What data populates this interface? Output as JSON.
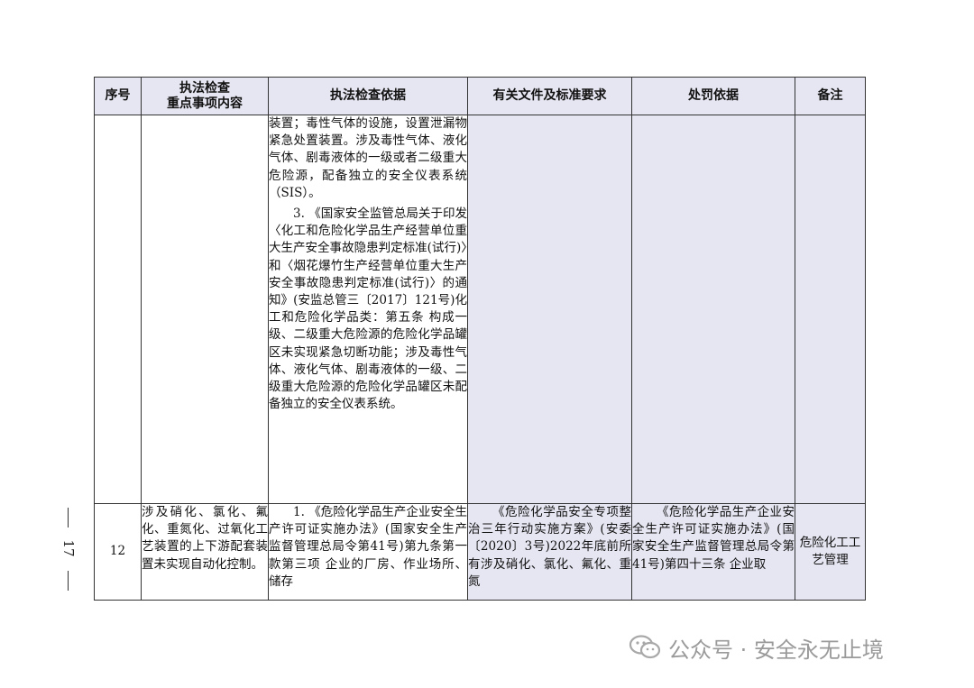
{
  "headers": [
    "序号",
    "执法检查\n重点事项内容",
    "执法检查依据",
    "有关文件及标准要求",
    "处罚依据",
    "备注"
  ],
  "row1": {
    "basis_p1": "装置；毒性气体的设施，设置泄漏物紧急处置装置。涉及毒性气体、液化气体、剧毒液体的一级或者二级重大危险源，配备独立的安全仪表系统（SIS）。",
    "basis_p2": "3. 《国家安全监管总局关于印发〈化工和危险化学品生产经营单位重大生产安全事故隐患判定标准(试行)〉和〈烟花爆竹生产经营单位重大生产安全事故隐患判定标准(试行)〉的通知》(安监总管三〔2017〕121号)化工和危险化学品类：第五条 构成一级、二级重大危险源的危险化学品罐区未实现紧急切断功能；涉及毒性气体、液化气体、剧毒液体的一级、二级重大危险源的危险化学品罐区未配备独立的安全仪表系统。"
  },
  "row2": {
    "seq": "12",
    "item": "涉及硝化、氯化、氟化、重氮化、过氧化工艺装置的上下游配套装置未实现自动化控制。",
    "basis": "1. 《危险化学品生产企业安全生产许可证实施办法》(国家安全生产监督管理总局令第41号)第九条第一款第三项 企业的厂房、作业场所、储存",
    "docs": "《危险化学品安全专项整治三年行动实施方案》(安委〔2020〕3号)2022年底前所有涉及硝化、氯化、氟化、重氮",
    "penalty": "《危险化学品生产企业安全生产许可证实施办法》(国家安全生产监督管理总局令第41号)第四十三条 企业取",
    "remark": "危险化工工艺管理"
  },
  "page_number": "17",
  "watermark": "公众号 · 安全永无止境",
  "colors": {
    "header_bg": "#e6e6f2",
    "border": "#333333",
    "watermark": "#9a9a9a"
  }
}
